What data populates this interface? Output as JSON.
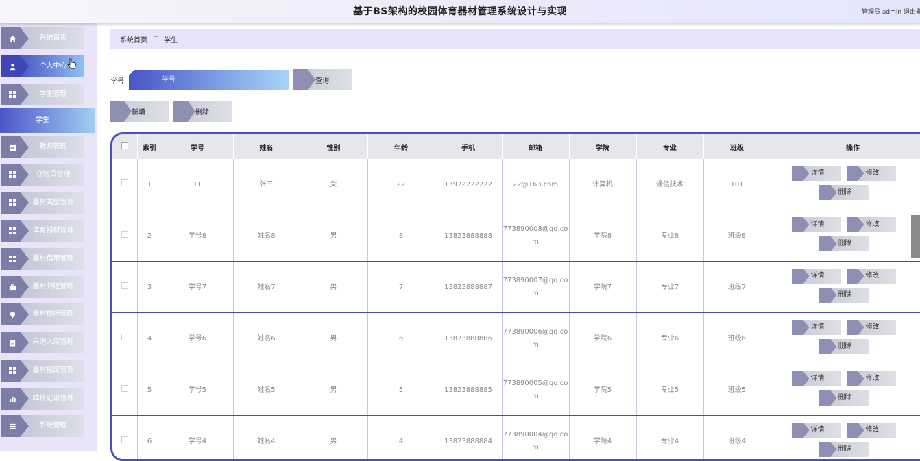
{
  "header": {
    "title": "基于BS架构的校园体育器材管理系统设计与实现",
    "user": "管理员 admin",
    "logout": "退出登"
  },
  "sidebar": {
    "items": [
      {
        "label": "系统首页",
        "icon": "home-icon"
      },
      {
        "label": "个人中心",
        "icon": "user-icon"
      },
      {
        "label": "学生管理",
        "icon": "grid-icon"
      },
      {
        "label": "教师管理",
        "icon": "chart-box-icon"
      },
      {
        "label": "仓管员管理",
        "icon": "grid-icon"
      },
      {
        "label": "器材类型管理",
        "icon": "grid-icon"
      },
      {
        "label": "体育器材管理",
        "icon": "grid-icon"
      },
      {
        "label": "器材借用管理",
        "icon": "grid-icon"
      },
      {
        "label": "器材归还管理",
        "icon": "briefcase-icon"
      },
      {
        "label": "器材损坏管理",
        "icon": "pin-icon"
      },
      {
        "label": "采购入库管理",
        "icon": "clipboard-icon"
      },
      {
        "label": "器材报废管理",
        "icon": "grid-icon"
      },
      {
        "label": "维修记录管理",
        "icon": "bar-chart-icon"
      },
      {
        "label": "系统管理",
        "icon": "list-icon"
      }
    ],
    "sub_item": "学生"
  },
  "breadcrumb": {
    "home": "系统首页",
    "separator": "☰",
    "current": "学生"
  },
  "search": {
    "label": "学号",
    "placeholder": "学号",
    "button": "查询"
  },
  "actions": {
    "add": "新增",
    "delete": "删除"
  },
  "table": {
    "columns": [
      "索引",
      "学号",
      "姓名",
      "性别",
      "年龄",
      "手机",
      "邮箱",
      "学院",
      "专业",
      "班级",
      "操作"
    ],
    "rows": [
      {
        "index": "1",
        "student_no": "11",
        "name": "张三",
        "gender": "女",
        "age": "22",
        "phone": "13922222222",
        "email": "22@163.com",
        "college": "计算机",
        "major": "通信技术",
        "class": "101"
      },
      {
        "index": "2",
        "student_no": "学号8",
        "name": "姓名8",
        "gender": "男",
        "age": "8",
        "phone": "13823888888",
        "email": "773890008@qq.com",
        "college": "学院8",
        "major": "专业8",
        "class": "班级8"
      },
      {
        "index": "3",
        "student_no": "学号7",
        "name": "姓名7",
        "gender": "男",
        "age": "7",
        "phone": "13823888887",
        "email": "773890007@qq.com",
        "college": "学院7",
        "major": "专业7",
        "class": "班级7"
      },
      {
        "index": "4",
        "student_no": "学号6",
        "name": "姓名6",
        "gender": "男",
        "age": "6",
        "phone": "13823888886",
        "email": "773890006@qq.com",
        "college": "学院6",
        "major": "专业6",
        "class": "班级6"
      },
      {
        "index": "5",
        "student_no": "学号5",
        "name": "姓名5",
        "gender": "男",
        "age": "5",
        "phone": "13823888885",
        "email": "773890005@qq.com",
        "college": "学院5",
        "major": "专业5",
        "class": "班级5"
      },
      {
        "index": "6",
        "student_no": "学号4",
        "name": "姓名4",
        "gender": "男",
        "age": "4",
        "phone": "13823888884",
        "email": "773890004@qq.com",
        "college": "学院4",
        "major": "专业4",
        "class": "班级4"
      }
    ],
    "row_actions": {
      "detail": "详情",
      "edit": "修改",
      "delete": "删除"
    }
  },
  "colors": {
    "accent": "#4d4fb9",
    "sidebar_bg": "#e9e4f7",
    "breadcrumb_bg": "#e7e3fa",
    "button_arrow": "#8f8fb3"
  }
}
